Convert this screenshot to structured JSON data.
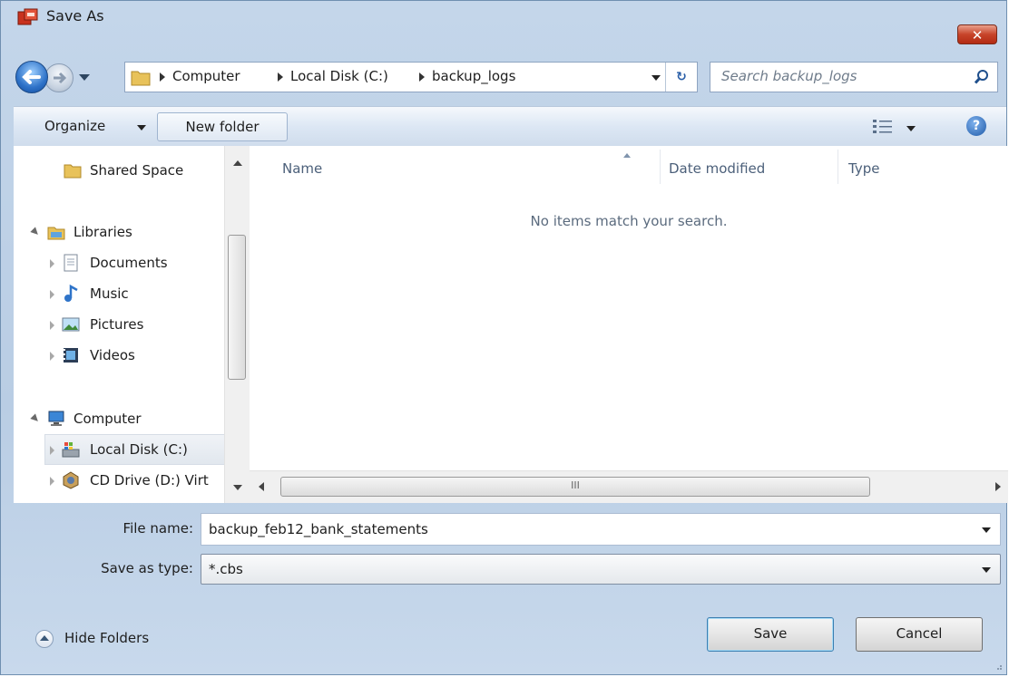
{
  "window": {
    "title": "Save As",
    "close_glyph": "✕"
  },
  "navigation": {
    "back_icon": "back-arrow-icon",
    "forward_icon": "forward-arrow-icon",
    "breadcrumbs": [
      "Computer",
      "Local Disk (C:)",
      "backup_logs"
    ],
    "refresh_glyph": "↻",
    "search_placeholder": "Search backup_logs"
  },
  "toolbar": {
    "organize_label": "Organize",
    "new_folder_label": "New folder",
    "views_icon": "views-icon",
    "help_glyph": "?"
  },
  "sidebar": {
    "items": [
      {
        "label": "Shared Space",
        "icon": "folder-icon"
      },
      {
        "label": "Libraries",
        "icon": "libraries-icon"
      },
      {
        "label": "Documents",
        "icon": "documents-icon"
      },
      {
        "label": "Music",
        "icon": "music-icon"
      },
      {
        "label": "Pictures",
        "icon": "pictures-icon"
      },
      {
        "label": "Videos",
        "icon": "videos-icon"
      },
      {
        "label": "Computer",
        "icon": "computer-icon"
      },
      {
        "label": "Local Disk (C:)",
        "icon": "local-disk-icon",
        "selected": true
      },
      {
        "label": "CD Drive (D:) Virt",
        "icon": "cd-drive-icon"
      }
    ]
  },
  "file_list": {
    "columns": [
      "Name",
      "Date modified",
      "Type"
    ],
    "empty_message": "No items match your search.",
    "hscroll_grip": "III"
  },
  "form": {
    "file_name_label": "File name:",
    "file_name_value": "backup_feb12_bank_statements",
    "save_type_label": "Save as type:",
    "save_type_value": "*.cbs"
  },
  "footer": {
    "hide_folders_label": "Hide Folders",
    "save_label": "Save",
    "cancel_label": "Cancel"
  },
  "colors": {
    "frame": "#c4d6ea",
    "accent_blue": "#2e72c8",
    "close_red": "#c7442a"
  }
}
